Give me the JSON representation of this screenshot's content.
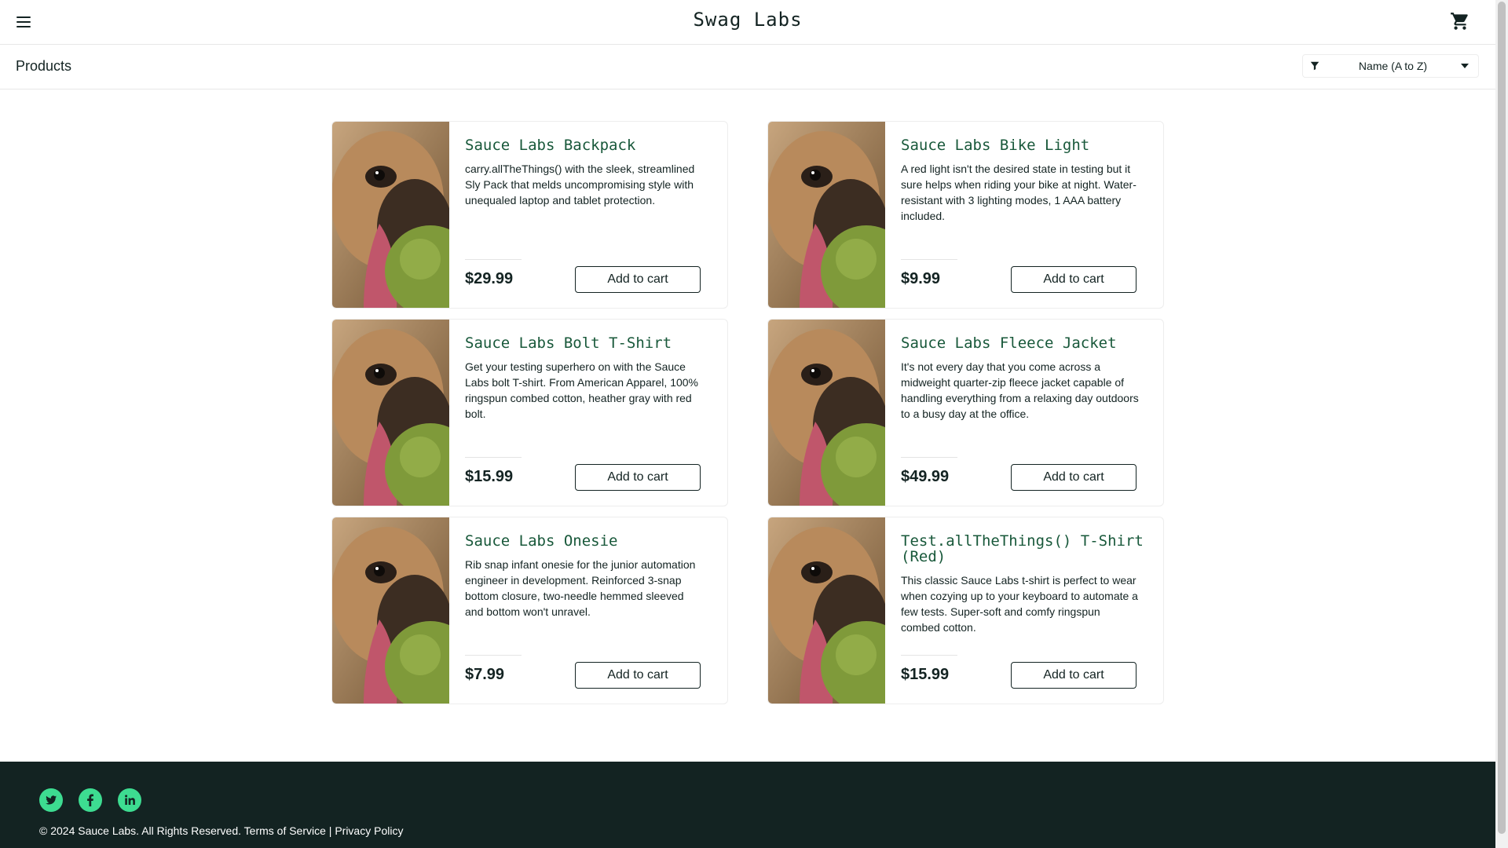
{
  "header": {
    "logo": "Swag Labs",
    "menu_icon": "hamburger-menu-icon",
    "cart_icon": "shopping-cart-icon"
  },
  "subheader": {
    "title": "Products",
    "sort_value": "Name (A to Z)"
  },
  "products": [
    {
      "name": "Sauce Labs Backpack",
      "description": "carry.allTheThings() with the sleek, streamlined Sly Pack that melds uncompromising style with unequaled laptop and tablet protection.",
      "price": "$29.99",
      "button": "Add to cart"
    },
    {
      "name": "Sauce Labs Bike Light",
      "description": "A red light isn't the desired state in testing but it sure helps when riding your bike at night. Water-resistant with 3 lighting modes, 1 AAA battery included.",
      "price": "$9.99",
      "button": "Add to cart"
    },
    {
      "name": "Sauce Labs Bolt T-Shirt",
      "description": "Get your testing superhero on with the Sauce Labs bolt T-shirt. From American Apparel, 100% ringspun combed cotton, heather gray with red bolt.",
      "price": "$15.99",
      "button": "Add to cart"
    },
    {
      "name": "Sauce Labs Fleece Jacket",
      "description": "It's not every day that you come across a midweight quarter-zip fleece jacket capable of handling everything from a relaxing day outdoors to a busy day at the office.",
      "price": "$49.99",
      "button": "Add to cart"
    },
    {
      "name": "Sauce Labs Onesie",
      "description": "Rib snap infant onesie for the junior automation engineer in development. Reinforced 3-snap bottom closure, two-needle hemmed sleeved and bottom won't unravel.",
      "price": "$7.99",
      "button": "Add to cart"
    },
    {
      "name": "Test.allTheThings() T-Shirt (Red)",
      "description": "This classic Sauce Labs t-shirt is perfect to wear when cozying up to your keyboard to automate a few tests. Super-soft and comfy ringspun combed cotton.",
      "price": "$15.99",
      "button": "Add to cart"
    }
  ],
  "footer": {
    "social": [
      "twitter-icon",
      "facebook-icon",
      "linkedin-icon"
    ],
    "copyright": "© 2024 Sauce Labs. All Rights Reserved. Terms of Service | Privacy Policy"
  },
  "colors": {
    "accent": "#3ddc91",
    "footer_bg": "#132322",
    "item_name": "#18583a"
  }
}
